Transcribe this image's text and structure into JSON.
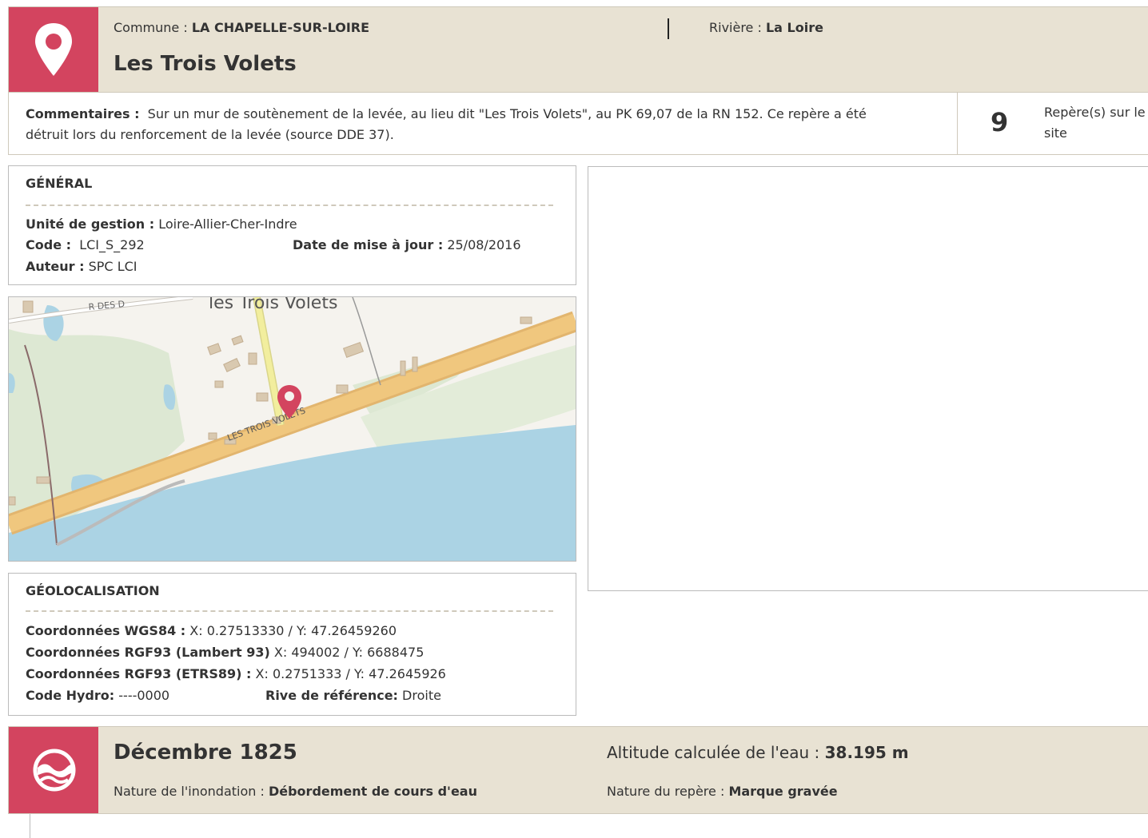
{
  "header": {
    "commune_label": "Commune : ",
    "commune": "LA CHAPELLE-SUR-LOIRE",
    "riviere_label": "Rivière : ",
    "riviere": "La Loire",
    "title": "Les Trois Volets",
    "icon": "map-pin-icon"
  },
  "comments": {
    "label": "Commentaires :",
    "text": "Sur un mur de soutènement de la levée, au lieu dit \"Les Trois Volets\", au PK 69,07 de la RN 152. Ce repère a été détruit lors du renforcement de la levée (source DDE 37).",
    "count": "9",
    "count_label": "Repère(s) sur le site"
  },
  "general": {
    "title": "GÉNÉRAL",
    "unite_label": "Unité de gestion :",
    "unite": "Loire-Allier-Cher-Indre",
    "code_label": "Code :",
    "code": "LCI_S_292",
    "date_label": "Date de mise à jour :",
    "date": "25/08/2016",
    "auteur_label": "Auteur :",
    "auteur": "SPC LCI"
  },
  "map": {
    "place_label": "les Trois Volets",
    "road_label": "LES TROIS VOLETS",
    "street_label": "R DES D",
    "marker_icon": "map-marker-icon"
  },
  "geo": {
    "title": "GÉOLOCALISATION",
    "wgs_label": "Coordonnées WGS84 :",
    "wgs": "X: 0.27513330 / Y: 47.26459260",
    "lambert_label": "Coordonnées RGF93 (Lambert 93)",
    "lambert": "X: 494002 / Y: 6688475",
    "etrs_label": "Coordonnées RGF93 (ETRS89) :",
    "etrs": "X: 0.2751333 / Y: 47.2645926",
    "hydro_label": "Code Hydro:",
    "hydro": "----0000",
    "rive_label": "Rive de référence:",
    "rive": "Droite"
  },
  "flood": {
    "icon": "flood-wave-icon",
    "title": "Décembre 1825",
    "nature_label": "Nature de l'inondation : ",
    "nature": "Débordement de cours d'eau",
    "altitude_label": "Altitude calculée de l'eau : ",
    "altitude": "38.195 m",
    "repere_label": "Nature du repère : ",
    "repere": "Marque gravée"
  },
  "colors": {
    "accent": "#d3445f",
    "header_bg": "#e8e2d3",
    "border": "#bbbbbb",
    "water": "#abd3e4",
    "road": "#f0c77e",
    "vegetation": "#dde8d3"
  }
}
